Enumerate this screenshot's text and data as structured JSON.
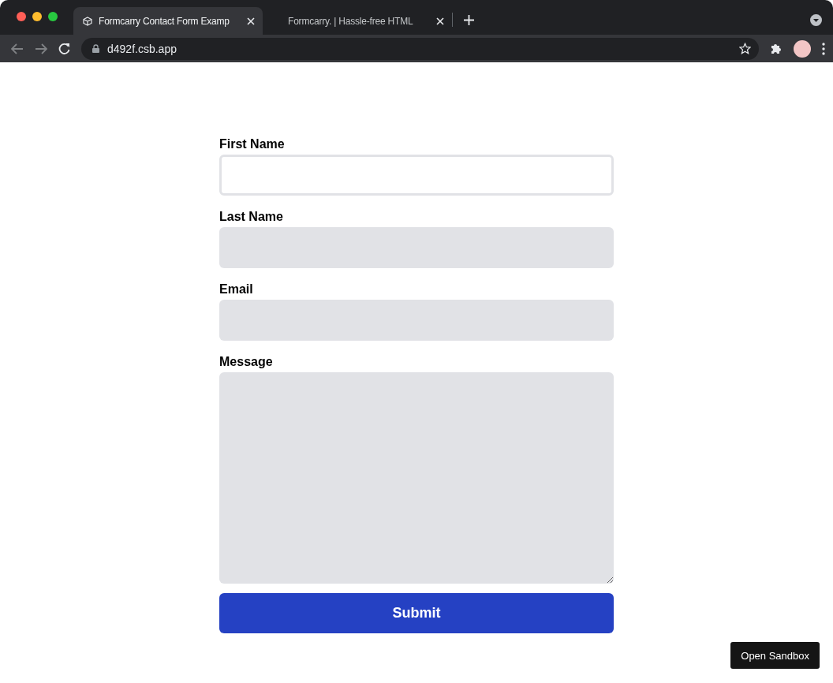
{
  "browser": {
    "tabs": [
      {
        "title": "Formcarry Contact Form Examp",
        "selected": true
      },
      {
        "title": "Formcarry. | Hassle-free HTML",
        "selected": false
      }
    ],
    "address": "d492f.csb.app"
  },
  "form": {
    "fields": [
      {
        "label": "First Name",
        "kind": "input",
        "focused": true
      },
      {
        "label": "Last Name",
        "kind": "input",
        "focused": false
      },
      {
        "label": "Email",
        "kind": "input",
        "focused": false
      },
      {
        "label": "Message",
        "kind": "textarea",
        "focused": false
      }
    ],
    "submit": "Submit"
  },
  "open_sandbox": "Open Sandbox"
}
